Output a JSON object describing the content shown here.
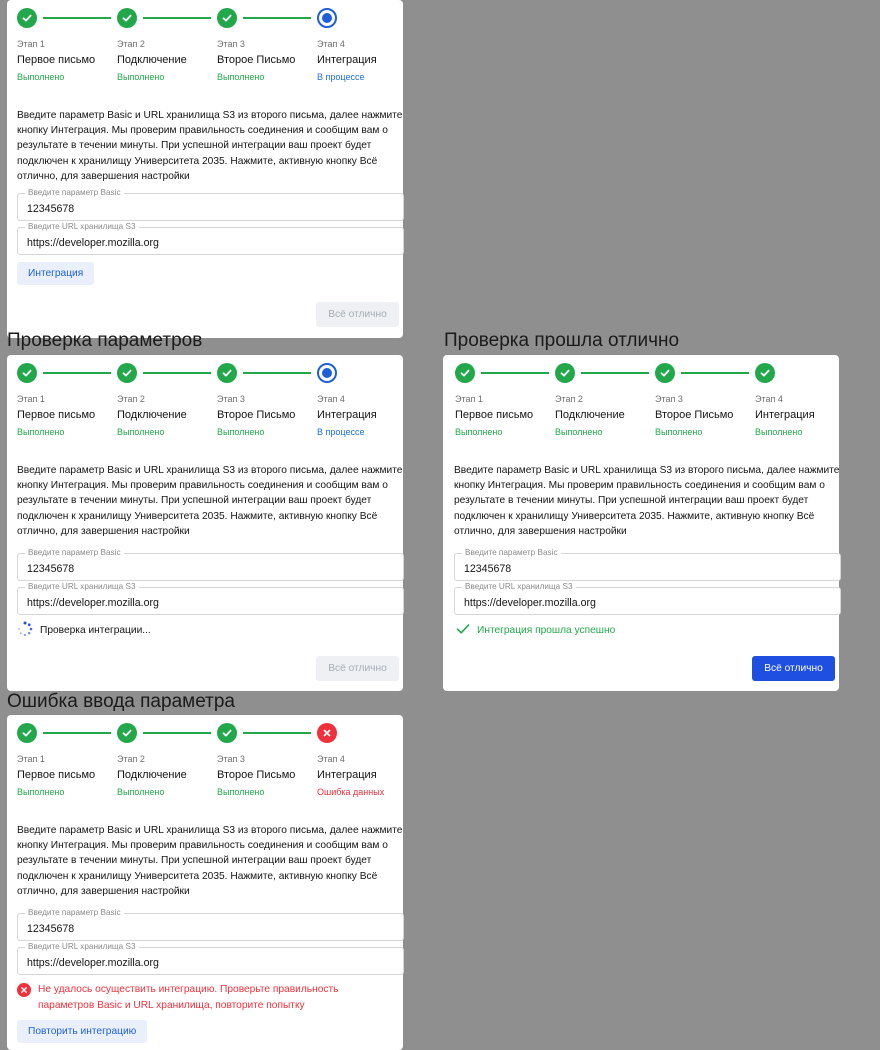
{
  "sections": [
    {
      "title": "",
      "steps": [
        {
          "num": "Этап 1",
          "name": "Первое письмо",
          "status": "Выполнено",
          "state": "done"
        },
        {
          "num": "Этап 2",
          "name": "Подключение",
          "status": "Выполнено",
          "state": "done"
        },
        {
          "num": "Этап 3",
          "name": "Второе Письмо",
          "status": "Выполнено",
          "state": "done"
        },
        {
          "num": "Этап 4",
          "name": "Интеграция",
          "status": "В процессе",
          "state": "progress"
        }
      ],
      "description": "Введите параметр Basic и URL хранилища S3 из второго письма, далее нажмите кнопку Интеграция. Мы проверим правильность соединения и сообщим вам о результате в течении минуты. При успешной интеграции ваш проект будет подключен к хранилищу Университета 2035. Нажмите, активную кнопку Всё отлично, для завершения настройки",
      "basic_label": "Введите параметр Basic",
      "basic_value": "12345678",
      "url_label": "Введите URL хранилища S3",
      "url_value": "https://developer.mozilla.org",
      "action_button": "Интеграция",
      "final_button": "Всё отлично"
    },
    {
      "title": "Проверка параметров",
      "steps": [
        {
          "num": "Этап 1",
          "name": "Первое письмо",
          "status": "Выполнено",
          "state": "done"
        },
        {
          "num": "Этап 2",
          "name": "Подключение",
          "status": "Выполнено",
          "state": "done"
        },
        {
          "num": "Этап 3",
          "name": "Второе Письмо",
          "status": "Выполнено",
          "state": "done"
        },
        {
          "num": "Этап 4",
          "name": "Интеграция",
          "status": "В процессе",
          "state": "progress"
        }
      ],
      "description": "Введите параметр Basic и URL хранилища S3 из второго письма, далее нажмите кнопку Интеграция. Мы проверим правильность соединения и сообщим вам о результате в течении минуты. При успешной интеграции ваш проект будет подключен к хранилищу Университета 2035. Нажмите, активную кнопку Всё отлично, для завершения настройки",
      "basic_label": "Введите параметр Basic",
      "basic_value": "12345678",
      "url_label": "Введите URL хранилища S3",
      "url_value": "https://developer.mozilla.org",
      "status_text": "Проверка интеграции...",
      "final_button": "Всё отлично"
    },
    {
      "title": "Проверка прошла отлично",
      "steps": [
        {
          "num": "Этап 1",
          "name": "Первое письмо",
          "status": "Выполнено",
          "state": "done"
        },
        {
          "num": "Этап 2",
          "name": "Подключение",
          "status": "Выполнено",
          "state": "done"
        },
        {
          "num": "Этап 3",
          "name": "Второе Письмо",
          "status": "Выполнено",
          "state": "done"
        },
        {
          "num": "Этап 4",
          "name": "Интеграция",
          "status": "Выполнено",
          "state": "done"
        }
      ],
      "description": "Введите параметр Basic и URL хранилища S3 из второго письма, далее нажмите кнопку Интеграция. Мы проверим правильность соединения и сообщим вам о результате в течении минуты. При успешной интеграции ваш проект будет подключен к хранилищу Университета 2035. Нажмите, активную кнопку Всё отлично, для завершения настройки",
      "basic_label": "Введите параметр Basic",
      "basic_value": "12345678",
      "url_label": "Введите URL хранилища S3",
      "url_value": "https://developer.mozilla.org",
      "status_text": "Интеграция прошла успешно",
      "final_button": "Всё отлично"
    },
    {
      "title": "Ошибка ввода параметра",
      "steps": [
        {
          "num": "Этап 1",
          "name": "Первое письмо",
          "status": "Выполнено",
          "state": "done"
        },
        {
          "num": "Этап 2",
          "name": "Подключение",
          "status": "Выполнено",
          "state": "done"
        },
        {
          "num": "Этап 3",
          "name": "Второе Письмо",
          "status": "Выполнено",
          "state": "done"
        },
        {
          "num": "Этап 4",
          "name": "Интеграция",
          "status": "Ошибка данных",
          "state": "error"
        }
      ],
      "description": "Введите параметр Basic и URL хранилища S3 из второго письма, далее нажмите кнопку Интеграция. Мы проверим правильность соединения и сообщим вам о результате в течении минуты. При успешной интеграции ваш проект будет подключен к хранилищу Университета 2035. Нажмите, активную кнопку Всё отлично, для завершения настройки",
      "basic_label": "Введите параметр Basic",
      "basic_value": "12345678",
      "url_label": "Введите URL хранилища S3",
      "url_value": "https://developer.mozilla.org",
      "status_text": "Не удалось осуществить интеграцию. Проверьте правильность параметров Basic и URL хранилища, повторите попытку",
      "action_button": "Повторить интеграцию"
    }
  ],
  "colors": {
    "done": "#22a84a",
    "progress": "#1f5fd6",
    "error": "#f0313c",
    "primary_button": "#1f4fe0",
    "background": "#8f8f8f"
  }
}
